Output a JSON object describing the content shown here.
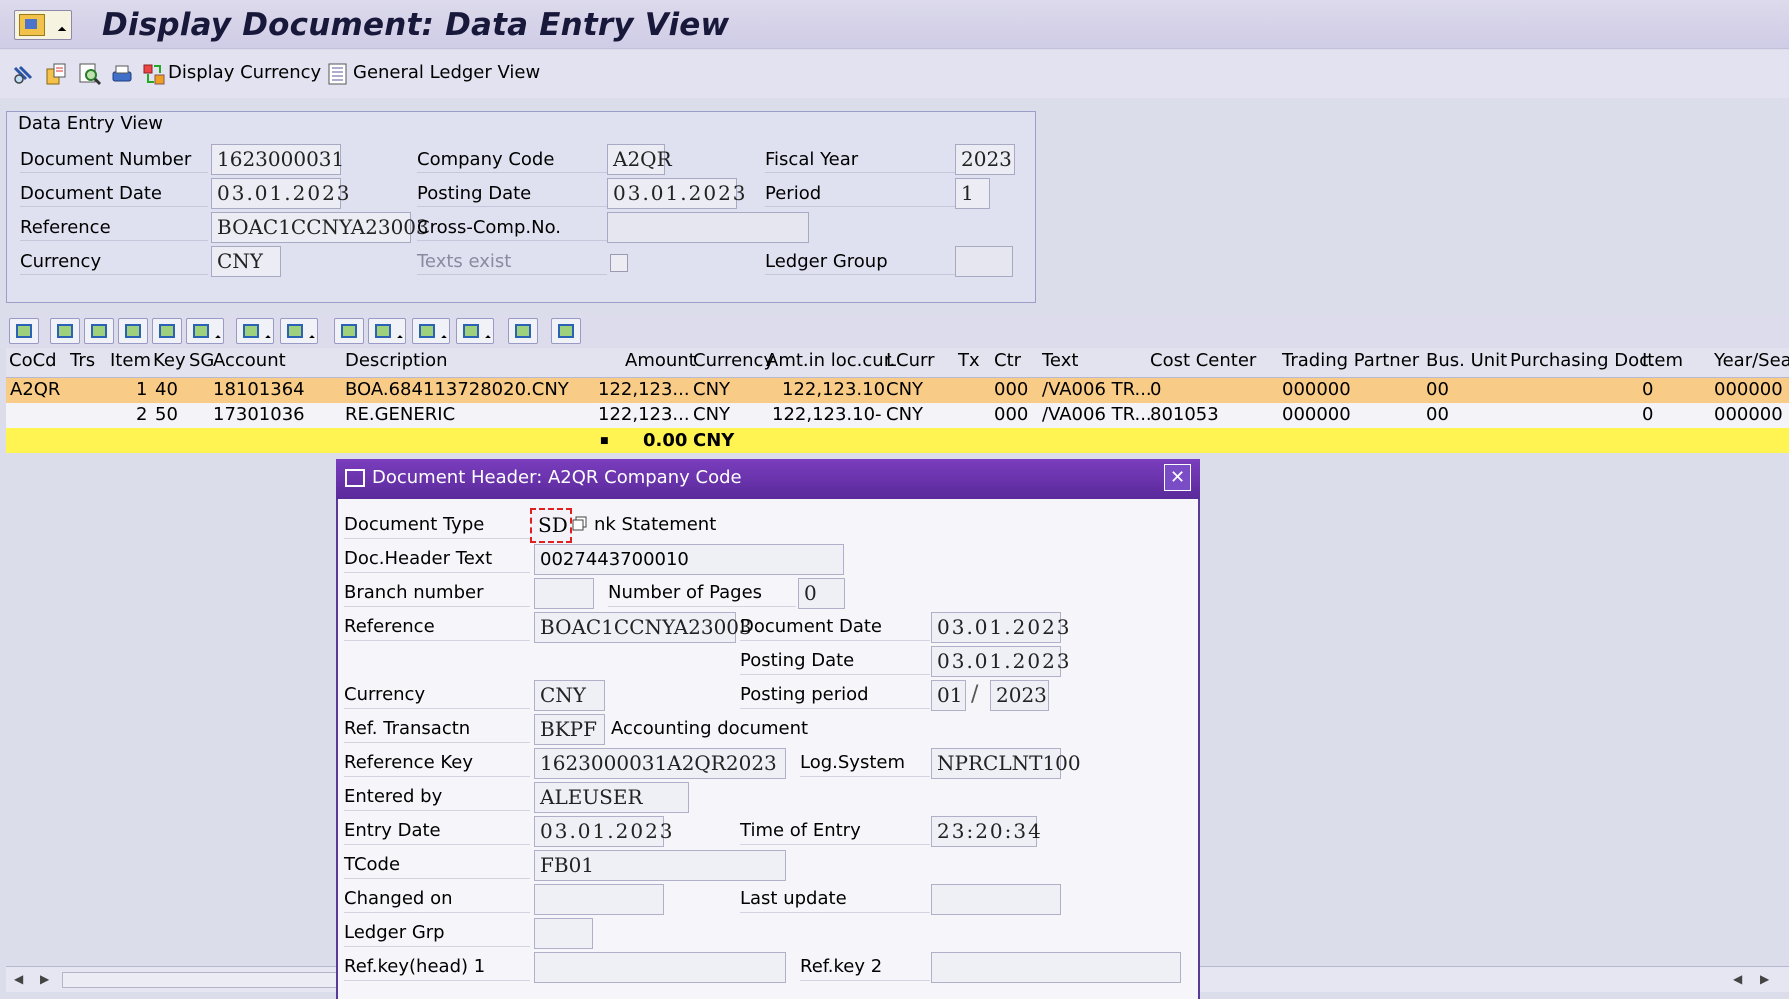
{
  "window": {
    "title": "Display Document: Data Entry View"
  },
  "toolbar": {
    "display_currency_label": "Display Currency",
    "gl_view_label": "General Ledger View",
    "icons": [
      "glasses-icon",
      "copy-icon",
      "overview-icon",
      "print-icon",
      "currency-icon",
      "ledger-icon"
    ]
  },
  "entry": {
    "group_title": "Data Entry View",
    "labels": {
      "doc_number": "Document Number",
      "company_code": "Company Code",
      "fiscal_year": "Fiscal Year",
      "doc_date": "Document Date",
      "posting_date": "Posting Date",
      "period": "Period",
      "reference": "Reference",
      "cross_comp": "Cross-Comp.No.",
      "currency": "Currency",
      "texts_exist": "Texts exist",
      "ledger_group": "Ledger Group"
    },
    "values": {
      "doc_number": "1623000031",
      "company_code": "A2QR",
      "fiscal_year": "2023",
      "doc_date": "03.01.2023",
      "posting_date": "03.01.2023",
      "period": "1",
      "reference": "BOAC1CCNYA23003",
      "cross_comp": "",
      "currency": "CNY",
      "ledger_group": ""
    }
  },
  "table": {
    "headers": [
      "CoCd",
      "Trs",
      "Item",
      "Key",
      "SG",
      "Account",
      "Description",
      "Amount",
      "Currency",
      "Amt.in loc.cur.",
      "LCurr",
      "Tx",
      "Ctr",
      "Text",
      "Cost Center",
      "Trading Partner",
      "Bus. Unit",
      "Purchasing Doc.",
      "Item",
      "Year/Sea"
    ],
    "rows": [
      {
        "cocd": "A2QR",
        "item": "1",
        "key": "40",
        "account": "18101364",
        "description": "BOA.684113728020.CNY",
        "amount": "122,123...",
        "currency": "CNY",
        "amt_loc": "122,123.10",
        "lcurr": "CNY",
        "ctr": "000",
        "text": "/VA006 TR...",
        "cost_center": "0",
        "trading_partner": "000000",
        "bus_unit": "00",
        "item2": "0",
        "year": "000000"
      },
      {
        "cocd": "",
        "item": "2",
        "key": "50",
        "account": "17301036",
        "description": "RE.GENERIC",
        "amount": "122,123...",
        "currency": "CNY",
        "amt_loc": "122,123.10-",
        "lcurr": "CNY",
        "ctr": "000",
        "text": "/VA006 TR...",
        "cost_center": "801053",
        "trading_partner": "000000",
        "bus_unit": "00",
        "item2": "0",
        "year": "000000"
      }
    ],
    "total": {
      "marker": "■",
      "amount": "0.00",
      "currency": "CNY"
    }
  },
  "dialog": {
    "title": "Document Header: A2QR Company Code",
    "labels": {
      "doc_type": "Document Type",
      "header_text": "Doc.Header Text",
      "branch": "Branch number",
      "pages": "Number of Pages",
      "reference": "Reference",
      "doc_date": "Document Date",
      "posting_date": "Posting Date",
      "currency": "Currency",
      "posting_period": "Posting period",
      "ref_trans": "Ref. Transactn",
      "ref_key": "Reference Key",
      "log_system": "Log.System",
      "entered_by": "Entered by",
      "entry_date": "Entry Date",
      "time_of_entry": "Time of Entry",
      "tcode": "TCode",
      "changed_on": "Changed on",
      "last_update": "Last update",
      "ledger_grp": "Ledger Grp",
      "refkey_head1": "Ref.key(head) 1",
      "refkey2": "Ref.key 2"
    },
    "values": {
      "doc_type": "SD",
      "doc_type_desc": "nk Statement",
      "header_text": "0027443700010",
      "branch": "",
      "pages": "0",
      "reference": "BOAC1CCNYA23003",
      "doc_date": "03.01.2023",
      "posting_date": "03.01.2023",
      "currency": "CNY",
      "period_month": "01",
      "period_sep": "/",
      "period_year": "2023",
      "ref_trans": "BKPF",
      "ref_trans_desc": "Accounting document",
      "ref_key": "1623000031A2QR2023",
      "log_system": "NPRCLNT100",
      "entered_by": "ALEUSER",
      "entry_date": "03.01.2023",
      "time_of_entry": "23:20:34",
      "tcode": "FB01",
      "changed_on": "",
      "last_update": "",
      "ledger_grp": "",
      "refkey_head1": "",
      "refkey2": ""
    }
  }
}
